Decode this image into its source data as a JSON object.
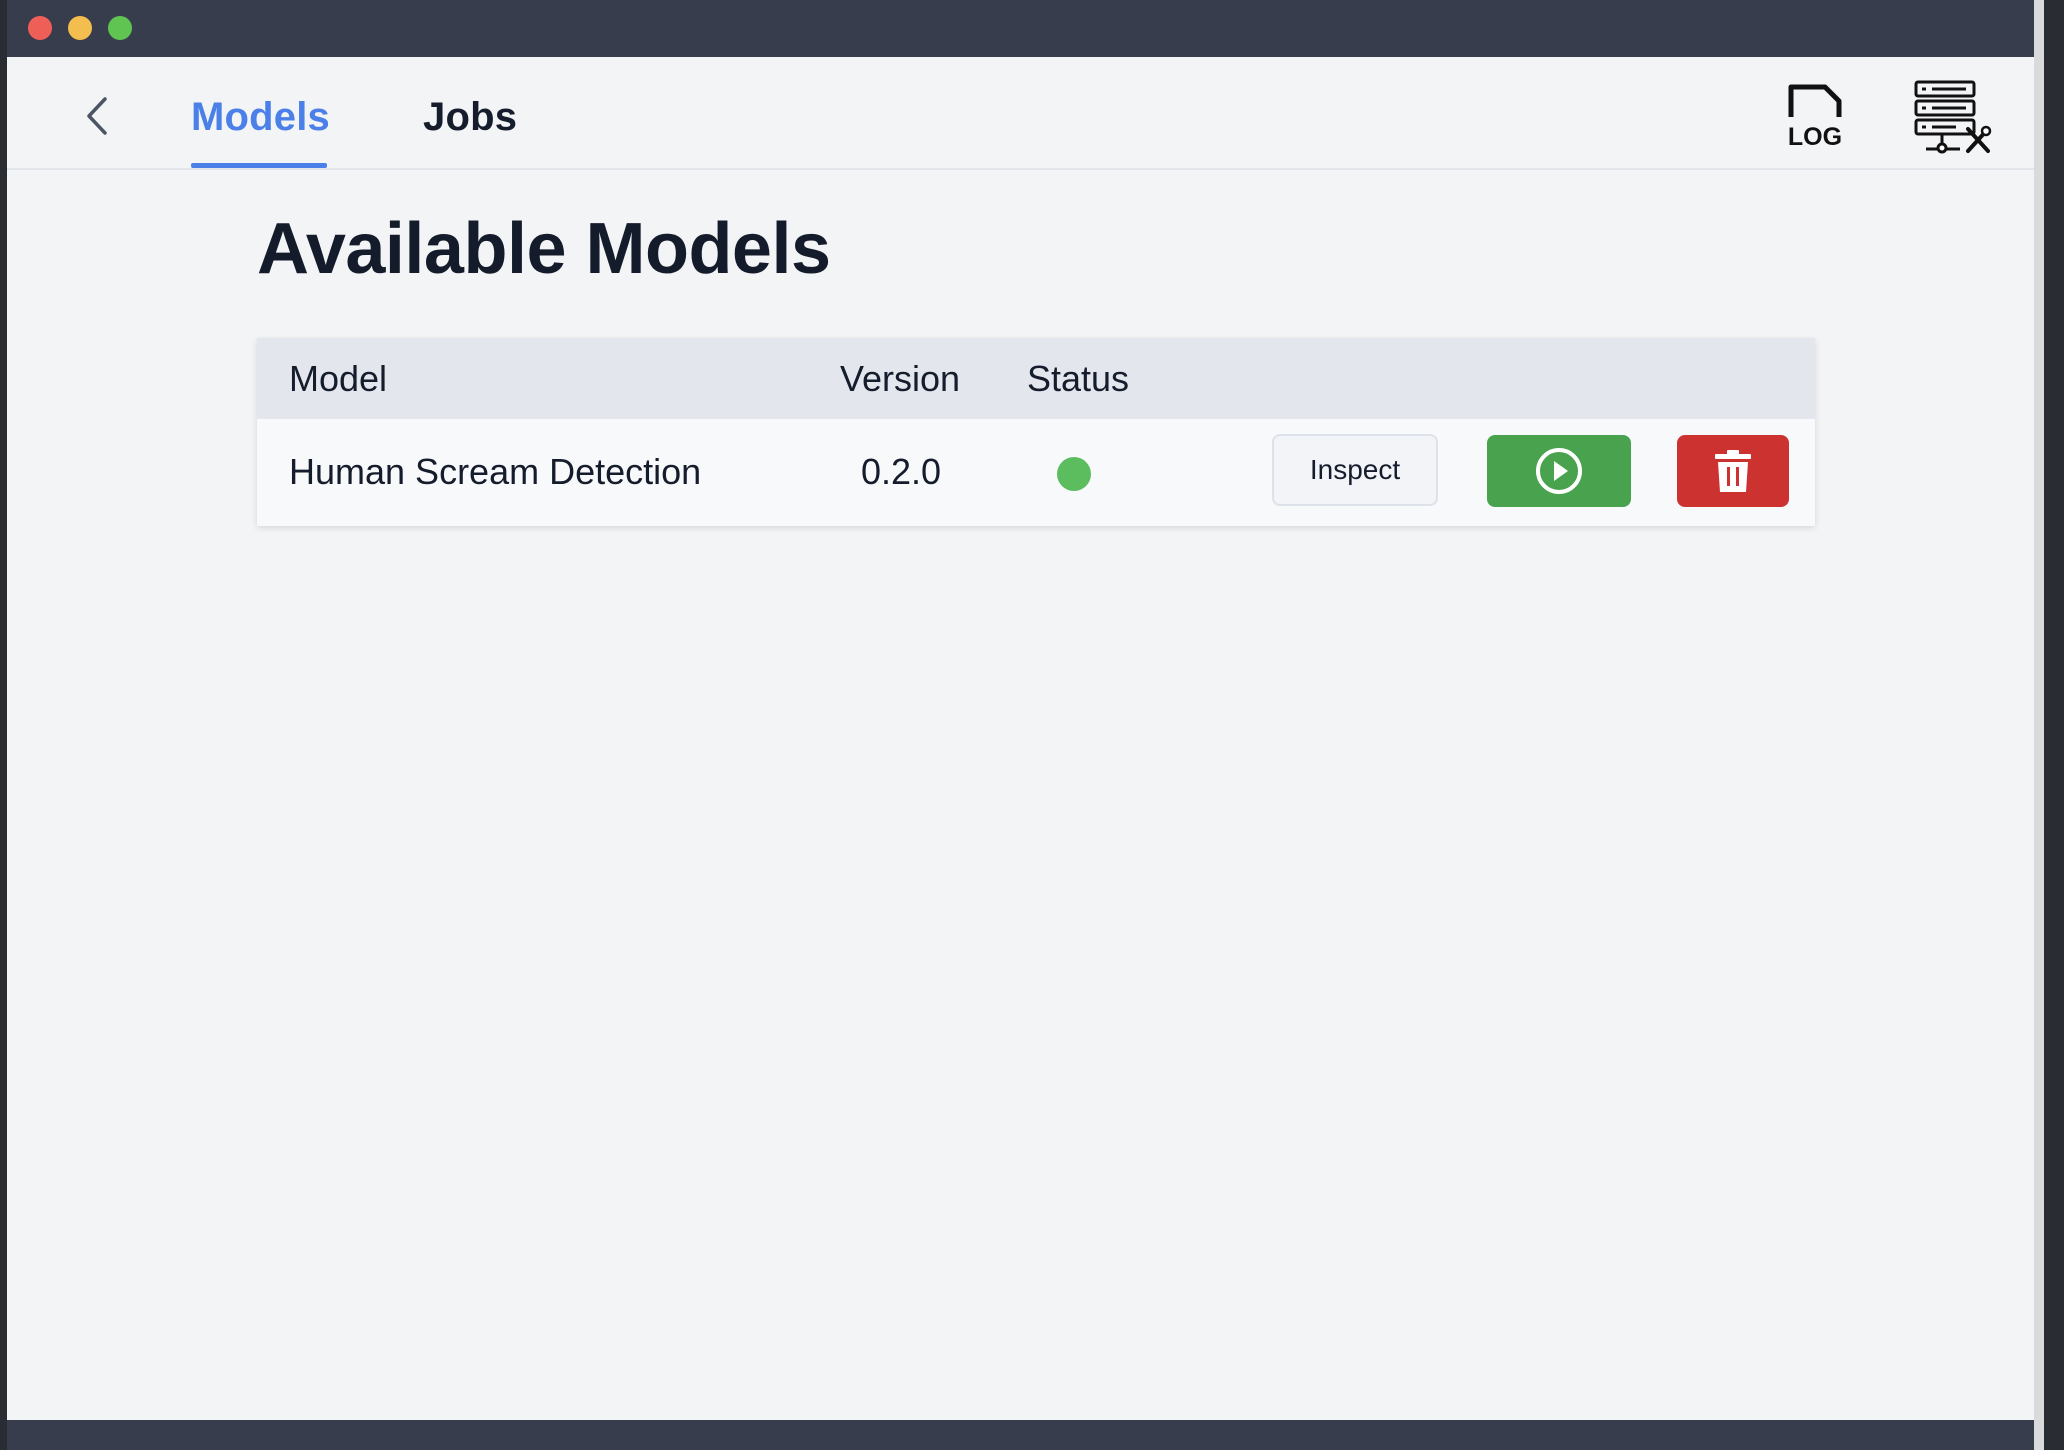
{
  "window": {
    "controls": [
      "close",
      "minimize",
      "maximize"
    ]
  },
  "nav": {
    "back_icon": "chevron-left-icon",
    "tabs": [
      {
        "label": "Models",
        "active": true
      },
      {
        "label": "Jobs",
        "active": false
      }
    ],
    "log_icon_label": "LOG",
    "server_icon": "server-tools-icon"
  },
  "page": {
    "title": "Available Models"
  },
  "table": {
    "columns": [
      "Model",
      "Version",
      "Status"
    ],
    "rows": [
      {
        "model": "Human Scream Detection",
        "version": "0.2.0",
        "status_color": "#5bbd5d",
        "inspect_label": "Inspect",
        "run_icon": "play-circle-icon",
        "delete_icon": "trash-icon"
      }
    ]
  },
  "colors": {
    "accent": "#4a80e8",
    "run": "#48a24e",
    "delete": "#cc3330",
    "status_active": "#5bbd5d",
    "titlebar": "#383d4d"
  }
}
